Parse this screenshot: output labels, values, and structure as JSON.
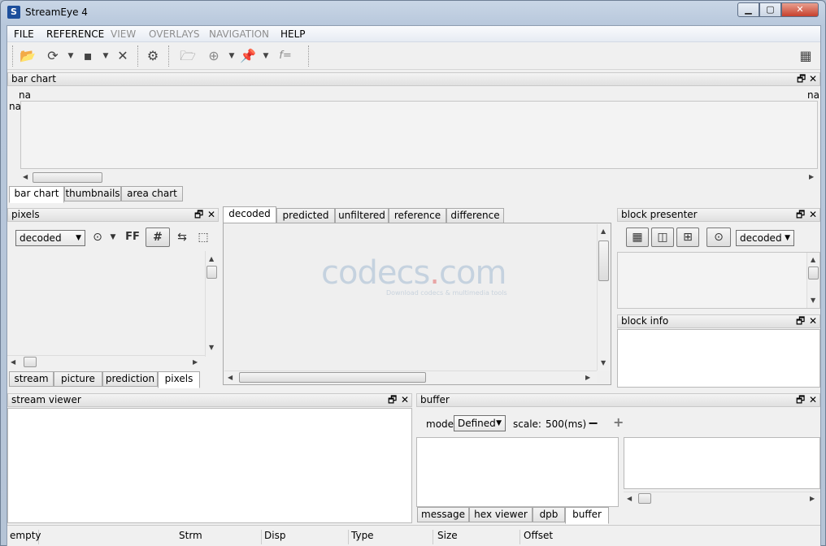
{
  "window": {
    "title": "StreamEye 4",
    "app_icon": "S"
  },
  "menu": [
    {
      "label": "FILE",
      "enabled": true
    },
    {
      "label": "REFERENCE",
      "enabled": true
    },
    {
      "label": "VIEW",
      "enabled": false
    },
    {
      "label": "OVERLAYS",
      "enabled": false
    },
    {
      "label": "NAVIGATION",
      "enabled": false
    },
    {
      "label": "HELP",
      "enabled": true
    }
  ],
  "toolbar": {
    "icons": [
      "open-folder-icon",
      "refresh-icon",
      "save-icon",
      "close-file-icon",
      "settings-gear-icon",
      "open-reference-icon",
      "reference-add-icon",
      "pin-icon",
      "formula-icon",
      "grid-menu-icon"
    ],
    "formula_label": "f="
  },
  "bar_chart": {
    "title": "bar chart",
    "label_top_left": "na",
    "label_top_right": "na",
    "label_left": "na",
    "tabs": [
      "bar chart",
      "thumbnails",
      "area chart"
    ],
    "active_tab": "bar chart"
  },
  "pixels": {
    "title": "pixels",
    "mode": "decoded",
    "ff_label": "FF",
    "tabs": [
      "stream",
      "picture",
      "prediction",
      "pixels"
    ],
    "active_tab": "pixels"
  },
  "center": {
    "tabs": [
      "decoded",
      "predicted",
      "unfiltered",
      "reference",
      "difference"
    ],
    "active_tab": "decoded",
    "watermark_main": "codecs",
    "watermark_dot": ".",
    "watermark_tld": "com",
    "watermark_sub": "Download codecs  & multimedia tools"
  },
  "block_presenter": {
    "title": "block presenter",
    "mode": "decoded"
  },
  "block_info": {
    "title": "block info"
  },
  "stream_viewer": {
    "title": "stream viewer"
  },
  "buffer": {
    "title": "buffer",
    "mode_label": "mode:",
    "mode_value": "Defined",
    "scale_label": "scale:",
    "scale_value": "500(ms)",
    "minus": "−",
    "plus": "+",
    "tabs": [
      "message",
      "hex viewer",
      "dpb",
      "buffer"
    ],
    "active_tab": "buffer"
  },
  "status_bar": [
    "empty",
    "Strm",
    "Disp",
    "Type",
    "Size",
    "Offset"
  ],
  "panel_buttons": {
    "float": "🗗",
    "close": "✕"
  }
}
